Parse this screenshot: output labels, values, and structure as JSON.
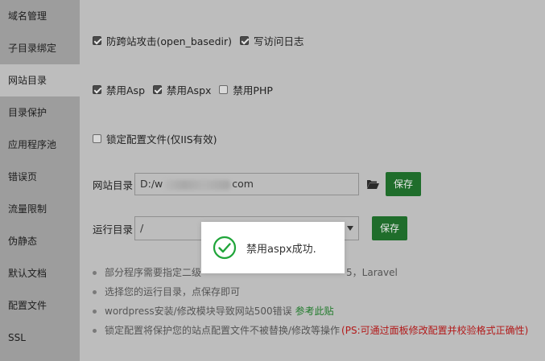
{
  "sidebar": {
    "items": [
      {
        "label": "域名管理",
        "active": false
      },
      {
        "label": "子目录绑定",
        "active": false
      },
      {
        "label": "网站目录",
        "active": true
      },
      {
        "label": "目录保护",
        "active": false
      },
      {
        "label": "应用程序池",
        "active": false
      },
      {
        "label": "错误页",
        "active": false
      },
      {
        "label": "流量限制",
        "active": false
      },
      {
        "label": "伪静态",
        "active": false
      },
      {
        "label": "默认文档",
        "active": false
      },
      {
        "label": "配置文件",
        "active": false
      },
      {
        "label": "SSL",
        "active": false
      }
    ]
  },
  "options": {
    "anti_xss": {
      "label": "防跨站攻击(open_basedir)",
      "checked": true
    },
    "access_log": {
      "label": "写访问日志",
      "checked": true
    },
    "disable_asp": {
      "label": "禁用Asp",
      "checked": true
    },
    "disable_aspx": {
      "label": "禁用Aspx",
      "checked": true
    },
    "disable_php": {
      "label": "禁用PHP",
      "checked": false
    },
    "lock_config": {
      "label": "锁定配置文件(仅IIS有效)",
      "checked": false
    }
  },
  "site_dir": {
    "label": "网站目录",
    "value_prefix": "D:/w",
    "value_suffix": "com",
    "save_label": "保存"
  },
  "run_dir": {
    "label": "运行目录",
    "value": "/",
    "save_label": "保存"
  },
  "tips": {
    "tip1": "部分程序需要指定二级",
    "tip1_end": "5，Laravel",
    "tip2": "选择您的运行目录，点保存即可",
    "tip3": "wordpress安装/修改模块导致网站500错误",
    "tip3_link": "参考此贴",
    "tip4": "锁定配置将保护您的站点配置文件不被替换/修改等操作",
    "tip4_red": "(PS:可通过面板修改配置并校验格式正确性)"
  },
  "toast": {
    "message": "禁用aspx成功.",
    "icon": "check-circle-icon",
    "icon_color": "#20a53a"
  },
  "colors": {
    "button_green": "#1f6d2b",
    "link_green": "#1f7a2a",
    "warning_red": "#b21a1a"
  }
}
